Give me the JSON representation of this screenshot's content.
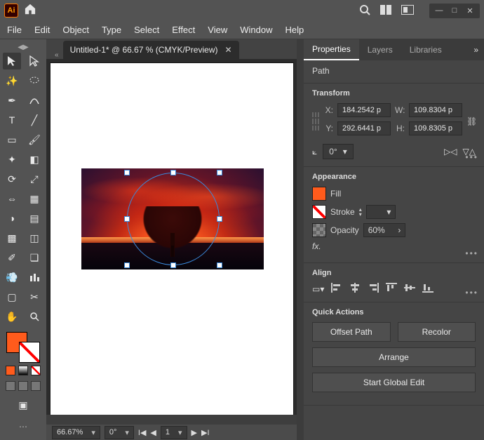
{
  "titlebar": {
    "logo_text": "Ai"
  },
  "menus": [
    "File",
    "Edit",
    "Object",
    "Type",
    "Select",
    "Effect",
    "View",
    "Window",
    "Help"
  ],
  "document": {
    "tab_label": "Untitled-1* @ 66.67 % (CMYK/Preview)"
  },
  "status": {
    "zoom": "66.67%",
    "rotation": "0°",
    "artboard_nav": "1"
  },
  "panel": {
    "tabs": [
      "Properties",
      "Layers",
      "Libraries"
    ],
    "object_kind": "Path",
    "transform": {
      "title": "Transform",
      "x_label": "X:",
      "y_label": "Y:",
      "w_label": "W:",
      "h_label": "H:",
      "x": "184.2542 p",
      "y": "292.6441 p",
      "w": "109.8304 p",
      "h": "109.8305 p",
      "angle": "0°"
    },
    "appearance": {
      "title": "Appearance",
      "fill_label": "Fill",
      "stroke_label": "Stroke",
      "opacity_label": "Opacity",
      "opacity_value": "60%",
      "fx_label": "fx."
    },
    "align": {
      "title": "Align"
    },
    "quick_actions": {
      "title": "Quick Actions",
      "offset": "Offset Path",
      "recolor": "Recolor",
      "arrange": "Arrange",
      "global_edit": "Start Global Edit"
    }
  },
  "colors": {
    "fill": "#ff5b1c"
  }
}
